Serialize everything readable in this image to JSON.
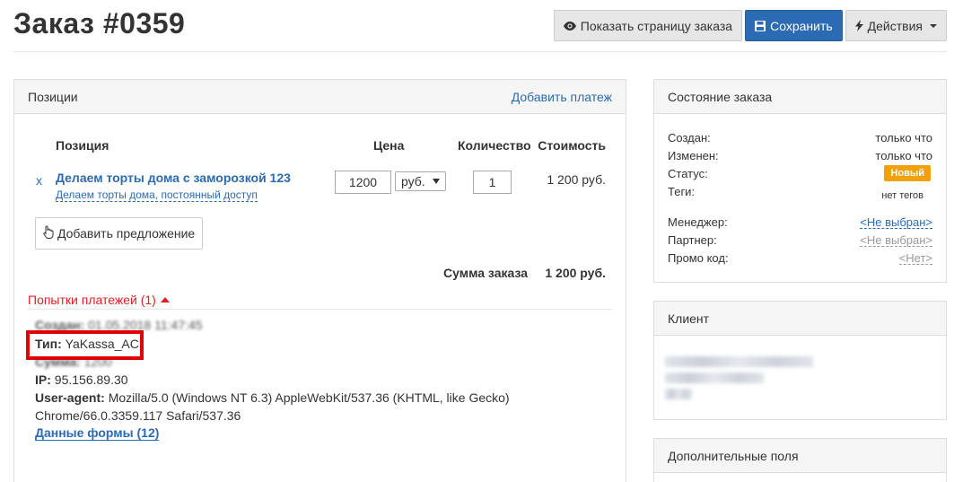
{
  "header": {
    "title": "Заказ #0359",
    "btn_show": "Показать страницу заказа",
    "btn_save": "Сохранить",
    "btn_actions": "Действия"
  },
  "positions": {
    "title": "Позиции",
    "add_payment": "Добавить платеж",
    "columns": {
      "position": "Позиция",
      "price": "Цена",
      "quantity": "Количество",
      "cost": "Стоимость"
    },
    "item": {
      "remove": "x",
      "name": "Делаем торты дома с заморозкой 123",
      "offer": "Делаем торты дома, постоянный доступ",
      "price": "1200",
      "currency": "руб.",
      "quantity": "1",
      "cost": "1 200 руб."
    },
    "add_offer": "Добавить предложение",
    "sum_label": "Сумма заказа",
    "sum_value": "1 200 руб.",
    "attempts_label": "Попытки платежей (1)",
    "payment": {
      "created_label": "Создан:",
      "created_value": "01.05.2018 11:47:45",
      "type_label": "Тип:",
      "type_value": "YaKassa_AC",
      "sum_label": "Сумма:",
      "sum_value": "1200",
      "ip_label": "IP:",
      "ip_value": "95.156.89.30",
      "ua_label": "User-agent:",
      "ua_value_1": "Mozilla/5.0 (Windows NT 6.3) AppleWebKit/537.36 (KHTML, like Gecko)",
      "ua_value_2": "Chrome/66.0.3359.117 Safari/537.36",
      "form_data": "Данные формы (12)"
    }
  },
  "order_state": {
    "title": "Состояние заказа",
    "created_label": "Создан:",
    "created_value": "только что",
    "changed_label": "Изменен:",
    "changed_value": "только что",
    "status_label": "Статус:",
    "status_value": "Новый",
    "tags_label": "Теги:",
    "tags_value": "нет тегов",
    "manager_label": "Менеджер:",
    "manager_value": "<Не выбран>",
    "partner_label": "Партнер:",
    "partner_value": "<Не выбран>",
    "promo_label": "Промо код:",
    "promo_value": "<Нет>"
  },
  "client": {
    "title": "Клиент"
  },
  "extra_fields": {
    "title": "Дополнительные поля"
  },
  "colors": {
    "primary": "#2a6bb3",
    "status_new": "#f0a00a",
    "attempts": "#e02020",
    "highlight": "#e00000"
  }
}
